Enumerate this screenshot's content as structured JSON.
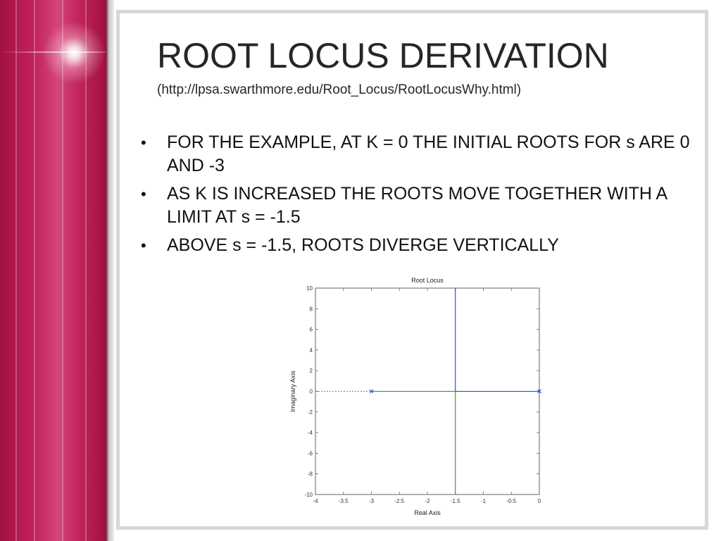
{
  "slide": {
    "title": "ROOT LOCUS DERIVATION",
    "subtitle": "(http://lpsa.swarthmore.edu/Root_Locus/RootLocusWhy.html)",
    "bullets": [
      "FOR THE EXAMPLE, AT K = 0 THE INITIAL ROOTS FOR s ARE 0 AND -3",
      "AS K IS INCREASED THE ROOTS MOVE TOGETHER WITH A LIMIT AT s = -1.5",
      "ABOVE s = -1.5, ROOTS DIVERGE VERTICALLY"
    ],
    "colors": {
      "accent_band": "#c0205a",
      "text": "#262626"
    }
  },
  "chart_data": {
    "type": "line",
    "title": "Root Locus",
    "xlabel": "Real Axis",
    "ylabel": "Imaginary Axis",
    "xlim": [
      -4,
      0
    ],
    "ylim": [
      -10,
      10
    ],
    "x_ticks": [
      -4,
      -3.5,
      -3,
      -2.5,
      -2,
      -1.5,
      -1,
      -0.5,
      0
    ],
    "y_ticks": [
      -10,
      -8,
      -6,
      -4,
      -2,
      0,
      2,
      4,
      6,
      8,
      10
    ],
    "grid": false,
    "series": [
      {
        "color": "#1f3fd8",
        "x": [
          -1.5,
          -1.5
        ],
        "y": [
          0,
          10
        ]
      },
      {
        "color": "#1f3fd8",
        "x": [
          -1.5,
          0
        ],
        "y": [
          0,
          0
        ]
      },
      {
        "color": "#2f8f2f",
        "x": [
          -3,
          -1.5
        ],
        "y": [
          0,
          0
        ]
      },
      {
        "color": "#2f8f2f",
        "x": [
          -1.5,
          -1.5
        ],
        "y": [
          0,
          -10
        ]
      }
    ],
    "dashed_line": {
      "color": "#555555",
      "x": [
        -4,
        0
      ],
      "y": [
        0,
        0
      ]
    },
    "poles": [
      {
        "x": -3,
        "y": 0,
        "color": "#1f3fd8"
      },
      {
        "x": 0,
        "y": 0,
        "color": "#1f3fd8"
      }
    ]
  }
}
